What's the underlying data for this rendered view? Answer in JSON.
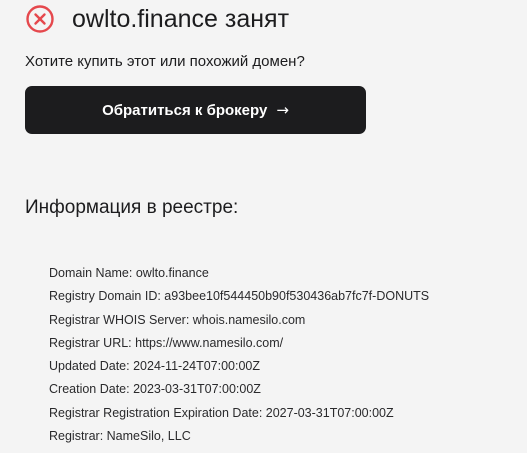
{
  "status": {
    "icon": "x-circle-icon",
    "icon_color": "#e5484d",
    "title": "owlto.finance занят"
  },
  "subtitle": "Хотите купить этот или похожий домен?",
  "broker_button": {
    "label": "Обратиться к брокеру",
    "arrow": "→"
  },
  "registry": {
    "heading": "Информация в реестре:",
    "lines": [
      "Domain Name: owlto.finance",
      "Registry Domain ID: a93bee10f544450b90f530436ab7fc7f-DONUTS",
      "Registrar WHOIS Server: whois.namesilo.com",
      "Registrar URL: https://www.namesilo.com/",
      "Updated Date: 2024-11-24T07:00:00Z",
      "Creation Date: 2023-03-31T07:00:00Z",
      "Registrar Registration Expiration Date: 2027-03-31T07:00:00Z",
      "Registrar: NameSilo, LLC"
    ]
  },
  "colors": {
    "background": "#f4f4f4",
    "button_bg": "#1c1c1e",
    "text": "#1c1c1e",
    "error": "#e5484d"
  }
}
